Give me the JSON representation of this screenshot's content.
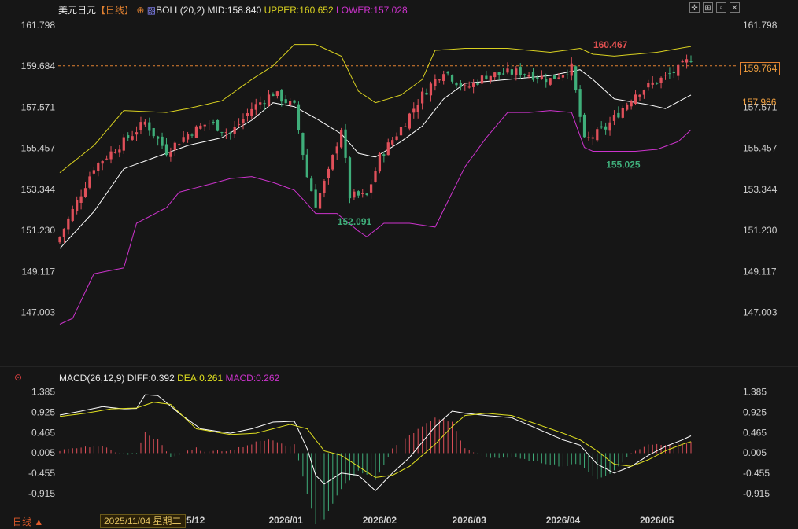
{
  "main_header": {
    "symbol": "美元日元",
    "period_tag": "【日线】",
    "indicator": "BOLL(20,2)",
    "mid": "MID:158.840",
    "upper": "UPPER:160.652",
    "lower": "LOWER:157.028"
  },
  "macd_header": {
    "indicator": "MACD(26,12,9)",
    "diff": "DIFF:0.392",
    "dea": "DEA:0.261",
    "macd": "MACD:0.262"
  },
  "price_axis_labels": [
    "161.798",
    "159.684",
    "157.571",
    "155.457",
    "153.344",
    "151.230",
    "149.117",
    "147.003"
  ],
  "macd_axis_labels": [
    "1.385",
    "0.925",
    "0.465",
    "0.005",
    "-0.455",
    "-0.915"
  ],
  "right_price_tags": {
    "current": "159.764",
    "mid": "157.986"
  },
  "x_labels": [
    "2025/12",
    "2026/01",
    "2026/02",
    "2026/03",
    "2026/04",
    "2026/05"
  ],
  "crosshair_date": "2025/11/04 星期二",
  "period_switch": "日线 ▲",
  "annotations": {
    "high": "160.467",
    "low1": "152.091",
    "low2": "155.025"
  },
  "colors": {
    "up": "#e0505a",
    "down": "#3fae7a",
    "upper": "#d8d020",
    "mid": "#ffffff",
    "lower": "#cc33cc",
    "diff": "#ffffff",
    "dea": "#e0e020",
    "dashed": "#e08030"
  },
  "chart_data": {
    "type": "candlestick",
    "ylim": [
      146.5,
      162.2
    ],
    "macd_ylim": [
      -1.2,
      1.5
    ],
    "close_anchors": [
      [
        0,
        150.9
      ],
      [
        8,
        154.5
      ],
      [
        15,
        155.8
      ],
      [
        20,
        156.8
      ],
      [
        25,
        155.3
      ],
      [
        30,
        156.2
      ],
      [
        35,
        156.8
      ],
      [
        40,
        156.2
      ],
      [
        45,
        157.5
      ],
      [
        50,
        158.3
      ],
      [
        55,
        157.6
      ],
      [
        58,
        154.0
      ],
      [
        60,
        152.6
      ],
      [
        63,
        154.2
      ],
      [
        66,
        156.5
      ],
      [
        68,
        153.0
      ],
      [
        72,
        153.0
      ],
      [
        75,
        155.0
      ],
      [
        80,
        156.5
      ],
      [
        85,
        158.2
      ],
      [
        90,
        159.5
      ],
      [
        95,
        158.5
      ],
      [
        100,
        159.2
      ],
      [
        108,
        159.4
      ],
      [
        115,
        159.0
      ],
      [
        120,
        159.6
      ],
      [
        123,
        155.8
      ],
      [
        128,
        156.5
      ],
      [
        135,
        158.3
      ],
      [
        140,
        158.9
      ],
      [
        145,
        159.5
      ],
      [
        148,
        160.1
      ]
    ],
    "upper_anchors": [
      [
        0,
        154.2
      ],
      [
        8,
        155.6
      ],
      [
        15,
        157.4
      ],
      [
        25,
        157.3
      ],
      [
        30,
        157.5
      ],
      [
        38,
        157.9
      ],
      [
        45,
        159.0
      ],
      [
        50,
        159.7
      ],
      [
        55,
        160.8
      ],
      [
        60,
        160.8
      ],
      [
        66,
        160.2
      ],
      [
        70,
        158.4
      ],
      [
        74,
        157.8
      ],
      [
        80,
        158.2
      ],
      [
        85,
        159.0
      ],
      [
        88,
        160.5
      ],
      [
        95,
        160.6
      ],
      [
        105,
        160.6
      ],
      [
        115,
        160.4
      ],
      [
        122,
        160.6
      ],
      [
        125,
        160.3
      ],
      [
        130,
        160.2
      ],
      [
        140,
        160.4
      ],
      [
        148,
        160.7
      ]
    ],
    "mid_anchors": [
      [
        0,
        150.3
      ],
      [
        8,
        152.2
      ],
      [
        15,
        154.4
      ],
      [
        25,
        155.2
      ],
      [
        30,
        155.6
      ],
      [
        38,
        156.0
      ],
      [
        45,
        156.9
      ],
      [
        50,
        157.8
      ],
      [
        55,
        157.6
      ],
      [
        60,
        157.0
      ],
      [
        66,
        156.2
      ],
      [
        70,
        155.2
      ],
      [
        74,
        155.0
      ],
      [
        80,
        155.8
      ],
      [
        85,
        156.6
      ],
      [
        90,
        158.0
      ],
      [
        95,
        158.8
      ],
      [
        105,
        159.0
      ],
      [
        115,
        159.2
      ],
      [
        122,
        159.5
      ],
      [
        125,
        159.0
      ],
      [
        130,
        158.0
      ],
      [
        138,
        157.7
      ],
      [
        142,
        157.5
      ],
      [
        148,
        158.2
      ]
    ],
    "lower_anchors": [
      [
        0,
        146.4
      ],
      [
        3,
        146.7
      ],
      [
        8,
        149.0
      ],
      [
        15,
        149.3
      ],
      [
        18,
        151.6
      ],
      [
        25,
        152.4
      ],
      [
        28,
        153.2
      ],
      [
        35,
        153.6
      ],
      [
        40,
        153.9
      ],
      [
        45,
        154.0
      ],
      [
        50,
        153.7
      ],
      [
        55,
        153.3
      ],
      [
        58,
        152.6
      ],
      [
        60,
        152.1
      ],
      [
        65,
        152.1
      ],
      [
        70,
        151.2
      ],
      [
        72,
        150.9
      ],
      [
        76,
        151.6
      ],
      [
        82,
        151.6
      ],
      [
        88,
        151.4
      ],
      [
        95,
        154.5
      ],
      [
        100,
        156.0
      ],
      [
        105,
        157.3
      ],
      [
        110,
        157.3
      ],
      [
        115,
        157.4
      ],
      [
        120,
        157.3
      ],
      [
        123,
        155.5
      ],
      [
        125,
        155.3
      ],
      [
        130,
        155.3
      ],
      [
        135,
        155.3
      ],
      [
        140,
        155.4
      ],
      [
        145,
        155.8
      ],
      [
        148,
        156.4
      ]
    ],
    "diff_anchors": [
      [
        0,
        0.86
      ],
      [
        5,
        0.95
      ],
      [
        10,
        1.05
      ],
      [
        15,
        1.0
      ],
      [
        18,
        1.01
      ],
      [
        20,
        1.32
      ],
      [
        23,
        1.3
      ],
      [
        28,
        0.9
      ],
      [
        33,
        0.55
      ],
      [
        40,
        0.45
      ],
      [
        45,
        0.55
      ],
      [
        50,
        0.7
      ],
      [
        55,
        0.72
      ],
      [
        58,
        0.1
      ],
      [
        60,
        -0.5
      ],
      [
        62,
        -0.7
      ],
      [
        66,
        -0.45
      ],
      [
        70,
        -0.5
      ],
      [
        74,
        -0.85
      ],
      [
        78,
        -0.45
      ],
      [
        82,
        -0.1
      ],
      [
        88,
        0.6
      ],
      [
        92,
        0.95
      ],
      [
        95,
        0.9
      ],
      [
        100,
        0.85
      ],
      [
        106,
        0.8
      ],
      [
        112,
        0.55
      ],
      [
        118,
        0.3
      ],
      [
        122,
        0.18
      ],
      [
        126,
        -0.25
      ],
      [
        130,
        -0.45
      ],
      [
        134,
        -0.3
      ],
      [
        138,
        -0.05
      ],
      [
        142,
        0.15
      ],
      [
        146,
        0.3
      ],
      [
        148,
        0.39
      ]
    ],
    "dea_anchors": [
      [
        0,
        0.83
      ],
      [
        6,
        0.9
      ],
      [
        12,
        1.0
      ],
      [
        18,
        1.02
      ],
      [
        22,
        1.15
      ],
      [
        26,
        1.1
      ],
      [
        32,
        0.55
      ],
      [
        40,
        0.42
      ],
      [
        46,
        0.45
      ],
      [
        50,
        0.55
      ],
      [
        54,
        0.65
      ],
      [
        58,
        0.55
      ],
      [
        62,
        0.05
      ],
      [
        66,
        -0.05
      ],
      [
        70,
        -0.3
      ],
      [
        74,
        -0.55
      ],
      [
        78,
        -0.5
      ],
      [
        82,
        -0.3
      ],
      [
        88,
        0.2
      ],
      [
        92,
        0.6
      ],
      [
        95,
        0.85
      ],
      [
        100,
        0.9
      ],
      [
        106,
        0.85
      ],
      [
        112,
        0.65
      ],
      [
        118,
        0.45
      ],
      [
        122,
        0.3
      ],
      [
        126,
        0.05
      ],
      [
        130,
        -0.25
      ],
      [
        134,
        -0.3
      ],
      [
        138,
        -0.15
      ],
      [
        142,
        0.05
      ],
      [
        146,
        0.2
      ],
      [
        148,
        0.26
      ]
    ],
    "candle_count": 149
  }
}
